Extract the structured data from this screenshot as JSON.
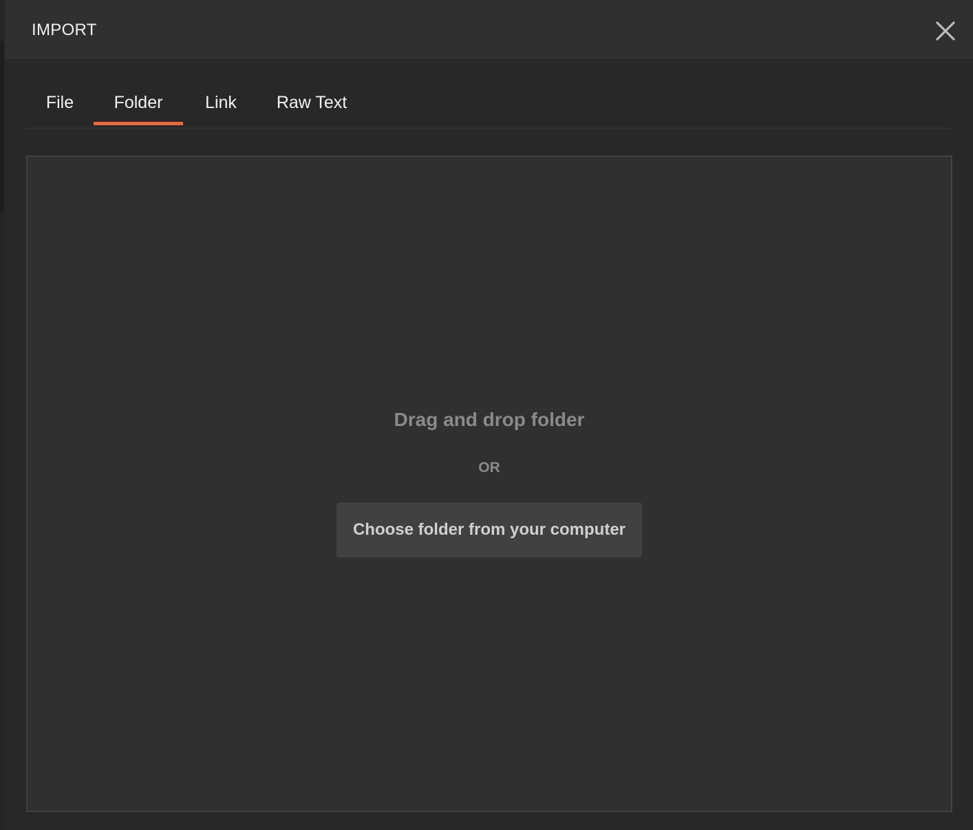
{
  "modal": {
    "title": "IMPORT",
    "close_icon": "close-icon"
  },
  "tabs": [
    {
      "label": "File",
      "active": false
    },
    {
      "label": "Folder",
      "active": true
    },
    {
      "label": "Link",
      "active": false
    },
    {
      "label": "Raw Text",
      "active": false
    }
  ],
  "dropzone": {
    "title": "Drag and drop folder",
    "or_text": "OR",
    "button_label": "Choose folder from your computer"
  },
  "colors": {
    "accent": "#e8693d",
    "background": "#282828",
    "header": "#303030",
    "dropzone": "#303030",
    "button": "#414141"
  }
}
